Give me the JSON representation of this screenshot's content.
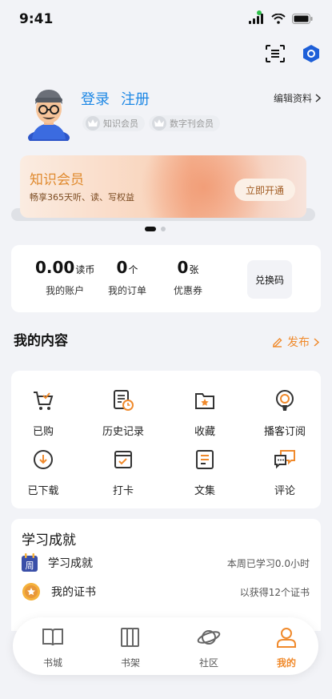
{
  "status": {
    "time": "9:41"
  },
  "profile": {
    "login": "登录",
    "register": "注册",
    "badge_knowledge": "知识会员",
    "badge_magazine": "数字刊会员",
    "edit": "编辑资料"
  },
  "banner": {
    "title": "知识会员",
    "subtitle": "畅享365天听、读、写权益",
    "button": "立即开通"
  },
  "stats": [
    {
      "num": "0.00",
      "unit": "读币",
      "label": "我的账户"
    },
    {
      "num": "0",
      "unit": "个",
      "label": "我的订单"
    },
    {
      "num": "0",
      "unit": "张",
      "label": "优惠券"
    }
  ],
  "redeem": "兑换码",
  "my_content": {
    "title": "我的内容",
    "publish": "发布"
  },
  "grid": [
    {
      "label": "已购",
      "icon": "cart-icon"
    },
    {
      "label": "历史记录",
      "icon": "history-icon"
    },
    {
      "label": "收藏",
      "icon": "favorite-folder-icon"
    },
    {
      "label": "播客订阅",
      "icon": "podcast-icon"
    },
    {
      "label": "已下载",
      "icon": "download-icon"
    },
    {
      "label": "打卡",
      "icon": "checkin-icon"
    },
    {
      "label": "文集",
      "icon": "collection-icon"
    },
    {
      "label": "评论",
      "icon": "comment-icon"
    }
  ],
  "achievements": {
    "title": "学习成就",
    "rows": [
      {
        "label": "学习成就",
        "value": "本周已学习0.0小时",
        "icon_text": "周"
      },
      {
        "label": "我的证书",
        "value": "以获得12个证书"
      }
    ]
  },
  "tabs": [
    {
      "label": "书城",
      "icon": "book-icon"
    },
    {
      "label": "书架",
      "icon": "bookshelf-icon"
    },
    {
      "label": "社区",
      "icon": "planet-icon"
    },
    {
      "label": "我的",
      "icon": "person-icon"
    }
  ],
  "colors": {
    "accent": "#f08a2c",
    "link": "#1e88e5",
    "background": "#f2f3f7"
  }
}
